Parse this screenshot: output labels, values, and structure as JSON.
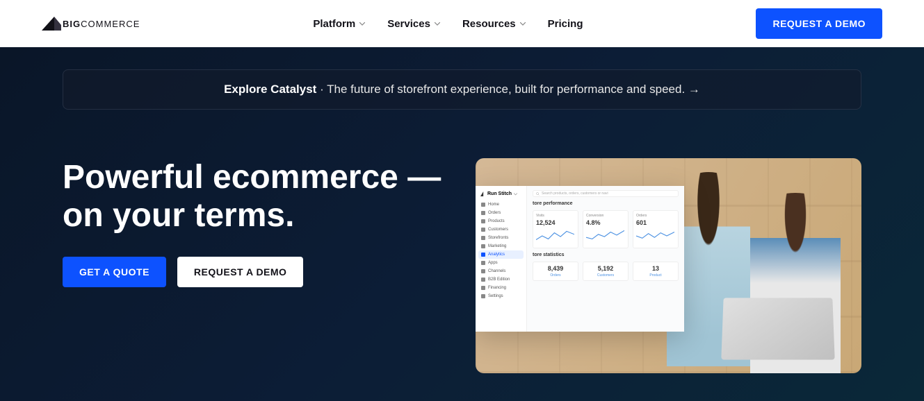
{
  "header": {
    "logo_bold": "BIG",
    "logo_thin": "COMMERCE",
    "nav": [
      "Platform",
      "Services",
      "Resources",
      "Pricing"
    ],
    "nav_has_dropdown": [
      true,
      true,
      true,
      false
    ],
    "demo_button": "REQUEST A DEMO"
  },
  "banner": {
    "bold": "Explore Catalyst",
    "separator": "·",
    "text": "The future of storefront experience, built for performance and speed.",
    "arrow": "→"
  },
  "hero": {
    "title_line1": "Powerful ecommerce —",
    "title_line2": "on your terms.",
    "quote_button": "GET A QUOTE",
    "demo_button": "REQUEST A DEMO"
  },
  "dashboard": {
    "store_name": "Run Stitch",
    "search_placeholder": "Search products, orders, customers or navi",
    "nav": [
      "Home",
      "Orders",
      "Products",
      "Customers",
      "Storefronts",
      "Marketing",
      "Analytics",
      "Apps",
      "Channels",
      "B2B Edition",
      "Financing",
      "Settings"
    ],
    "active_nav_index": 6,
    "section1_title": "tore performance",
    "metrics": [
      {
        "label": "Visits",
        "value": "12,524"
      },
      {
        "label": "Conversion",
        "value": "4.8%"
      },
      {
        "label": "Orders",
        "value": "601"
      }
    ],
    "section2_title": "tore statistics",
    "stats": [
      {
        "value": "8,439",
        "label": "Orders"
      },
      {
        "value": "5,192",
        "label": "Customers"
      },
      {
        "value": "13",
        "label": "Product"
      }
    ]
  }
}
